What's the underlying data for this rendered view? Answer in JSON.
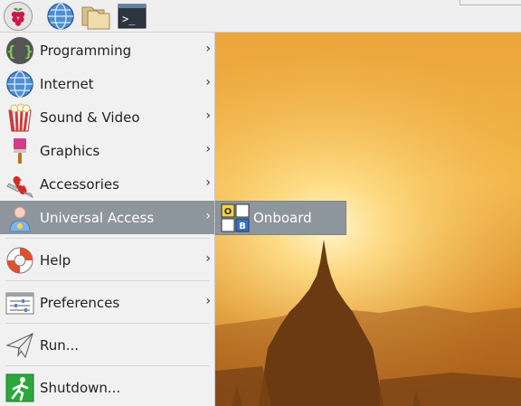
{
  "taskbar": {
    "icons": [
      "raspberry-pi-menu-icon",
      "web-browser-icon",
      "file-manager-icon",
      "terminal-icon"
    ],
    "terminal_glyph": ">_"
  },
  "menu": {
    "items": [
      {
        "label": "Programming",
        "icon": "programming-icon",
        "has_submenu": true
      },
      {
        "label": "Internet",
        "icon": "internet-globe-icon",
        "has_submenu": true
      },
      {
        "label": "Sound & Video",
        "icon": "sound-video-icon",
        "has_submenu": true
      },
      {
        "label": "Graphics",
        "icon": "graphics-brush-icon",
        "has_submenu": true
      },
      {
        "label": "Accessories",
        "icon": "accessories-knife-icon",
        "has_submenu": true
      },
      {
        "label": "Universal Access",
        "icon": "universal-access-person-icon",
        "has_submenu": true,
        "selected": true
      },
      {
        "label": "Help",
        "icon": "help-lifebuoy-icon",
        "has_submenu": true
      },
      {
        "label": "Preferences",
        "icon": "preferences-sliders-icon",
        "has_submenu": true
      },
      {
        "label": "Run...",
        "icon": "run-paper-plane-icon",
        "has_submenu": false
      },
      {
        "label": "Shutdown...",
        "icon": "shutdown-exit-icon",
        "has_submenu": false
      }
    ],
    "arrow_glyph": "›",
    "selected_color": "#8d969d"
  },
  "submenu": {
    "items": [
      {
        "label": "Onboard",
        "icon": "onboard-keyboard-icon"
      }
    ],
    "icon_letters": [
      "O",
      "B"
    ]
  },
  "colors": {
    "menu_background": "#f1f1f1",
    "highlight": "#8d969d",
    "taskbar": "#efefef"
  }
}
